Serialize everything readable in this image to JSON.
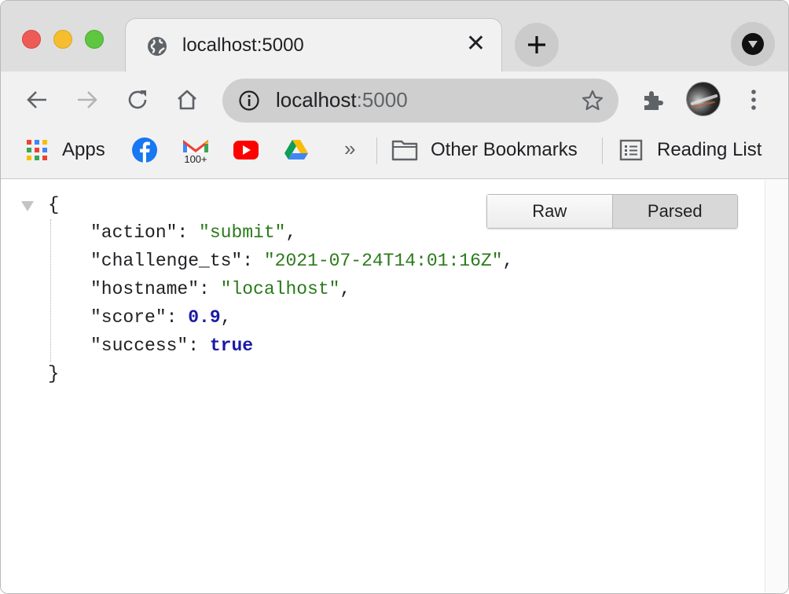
{
  "tab": {
    "title": "localhost:5000",
    "close_glyph": "✕"
  },
  "omnibox": {
    "host": "localhost",
    "port": ":5000"
  },
  "bookmarks": {
    "apps_label": "Apps",
    "items": [
      {
        "name": "facebook",
        "icon": "facebook-icon"
      },
      {
        "name": "gmail",
        "icon": "gmail-icon",
        "badge": "100+"
      },
      {
        "name": "youtube",
        "icon": "youtube-icon"
      },
      {
        "name": "google-drive",
        "icon": "google-drive-icon"
      }
    ],
    "overflow_glyph": "»",
    "other_label": "Other Bookmarks",
    "reading_list_label": "Reading List"
  },
  "viewer": {
    "raw_label": "Raw",
    "parsed_label": "Parsed",
    "active": "Parsed"
  },
  "json": {
    "open_brace": "{",
    "close_brace": "}",
    "lines": [
      {
        "key": "\"action\"",
        "value": "\"submit\"",
        "type": "string",
        "trail": ","
      },
      {
        "key": "\"challenge_ts\"",
        "value": "\"2021-07-24T14:01:16Z\"",
        "type": "string",
        "trail": ","
      },
      {
        "key": "\"hostname\"",
        "value": "\"localhost\"",
        "type": "string",
        "trail": ","
      },
      {
        "key": "\"score\"",
        "value": "0.9",
        "type": "number",
        "trail": ","
      },
      {
        "key": "\"success\"",
        "value": "true",
        "type": "boolean",
        "trail": ""
      }
    ]
  },
  "colors": {
    "string": "#2a7a1a",
    "number": "#1a1aa6",
    "chrome_bg": "#f1f1f1",
    "tabstrip_bg": "#dedede"
  }
}
